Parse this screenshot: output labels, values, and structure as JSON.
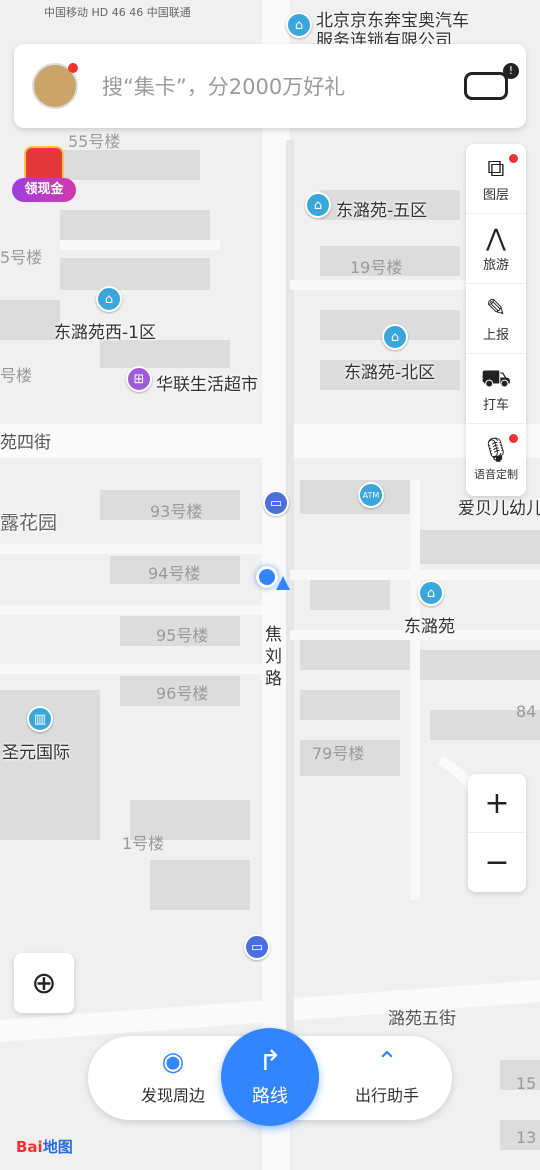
{
  "status": {
    "carrier": "中国移动 HD 46 46 中国联通",
    "right": "北京京东奔宝奥汽车 服务连锁有限公司"
  },
  "search": {
    "placeholder": "搜“集卡”，分2000万好礼"
  },
  "redpack": {
    "label": "领现金"
  },
  "side_tools": [
    {
      "icon": "layers-icon",
      "label": "图层"
    },
    {
      "icon": "travel-icon",
      "label": "旅游"
    },
    {
      "icon": "report-icon",
      "label": "上报"
    },
    {
      "icon": "taxi-icon",
      "label": "打车"
    },
    {
      "icon": "mic-icon",
      "label": "语音定制"
    }
  ],
  "zoom": {
    "in": "+",
    "out": "−"
  },
  "bottom": {
    "discover": "发现周边",
    "route": "路线",
    "assistant": "出行助手"
  },
  "logo": {
    "bai": "Bai",
    "du": "地图"
  },
  "map": {
    "building_labels": [
      "55号楼",
      "19号楼",
      "93号楼",
      "94号楼",
      "95号楼",
      "96号楼",
      "79号楼",
      "1号楼",
      "5号楼",
      "号楼",
      "84",
      "15",
      "13"
    ],
    "street_labels": [
      "苑四街",
      "露花园",
      "焦",
      "刘",
      "路",
      "潞苑五街"
    ],
    "pois": [
      "东潞苑-五区",
      "东潞苑西-1区",
      "东潞苑-北区",
      "华联生活超市",
      "东潞苑",
      "圣元国际",
      "爱贝儿幼儿",
      "北京京东奔宝奥汽车",
      "服务连锁有限公司"
    ],
    "markers": [
      "ATM",
      "bus-stop",
      "bus-stop"
    ]
  }
}
